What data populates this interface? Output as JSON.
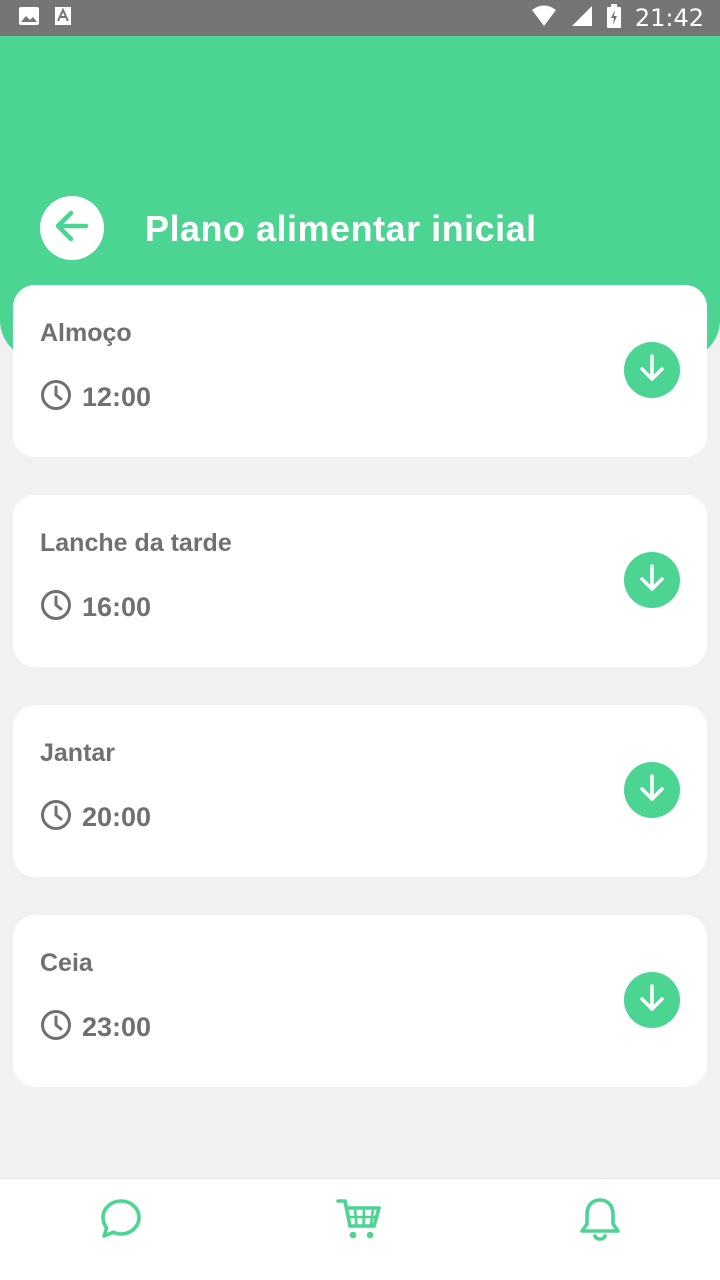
{
  "status_bar": {
    "time": "21:42",
    "icons": [
      "image-icon",
      "text-a-icon",
      "wifi-icon",
      "signal-icon",
      "battery-charging-icon"
    ]
  },
  "header": {
    "title": "Plano alimentar inicial",
    "back_icon": "arrow-left-icon"
  },
  "meals": [
    {
      "name": "Almoço",
      "time": "12:00"
    },
    {
      "name": "Lanche da tarde",
      "time": "16:00"
    },
    {
      "name": "Jantar",
      "time": "20:00"
    },
    {
      "name": "Ceia",
      "time": "23:00"
    }
  ],
  "bottom_nav": {
    "items": [
      "chat-icon",
      "cart-icon",
      "bell-icon"
    ]
  },
  "colors": {
    "accent": "#4cd493",
    "text": "#707070",
    "background": "#f1f1f1",
    "status_bar": "#757575"
  }
}
